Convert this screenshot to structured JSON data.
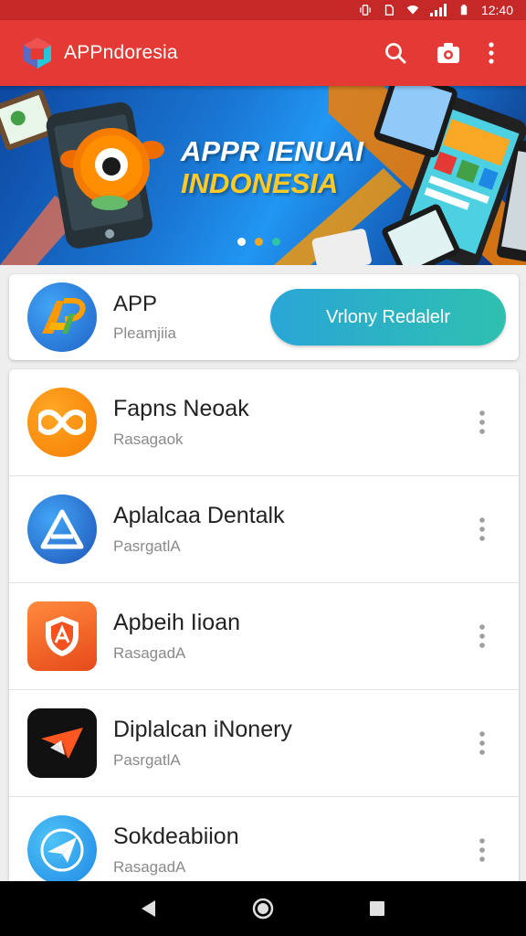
{
  "status_bar": {
    "time": "12:40"
  },
  "app_bar": {
    "title": "APPndoresia",
    "icons": [
      "search-icon",
      "camera-icon",
      "overflow-icon"
    ]
  },
  "banner": {
    "line1": "APPR IENUAI",
    "line2": "INDONESIA",
    "dot_colors": [
      "#ffffff",
      "#f5a623",
      "#2ec4a6"
    ]
  },
  "featured": {
    "name": "APP",
    "subtitle": "Pleamjiia",
    "button_label": "Vrlony Redalelr"
  },
  "apps": [
    {
      "name": "Fapns Neoak",
      "subtitle": "Rasagaok"
    },
    {
      "name": "Aplalcaa Dentalk",
      "subtitle": "PasrgatlA"
    },
    {
      "name": "Apbeih Iioan",
      "subtitle": "RasagadA"
    },
    {
      "name": "Diplalcan iNonery",
      "subtitle": "PasrgatlA"
    },
    {
      "name": "Sokdeabiion",
      "subtitle": "RasagadA"
    }
  ],
  "colors": {
    "app_bar": "#e53935",
    "status_bar": "#c62828",
    "accent_button": "#29a6d6",
    "banner_highlight": "#ffc928"
  }
}
